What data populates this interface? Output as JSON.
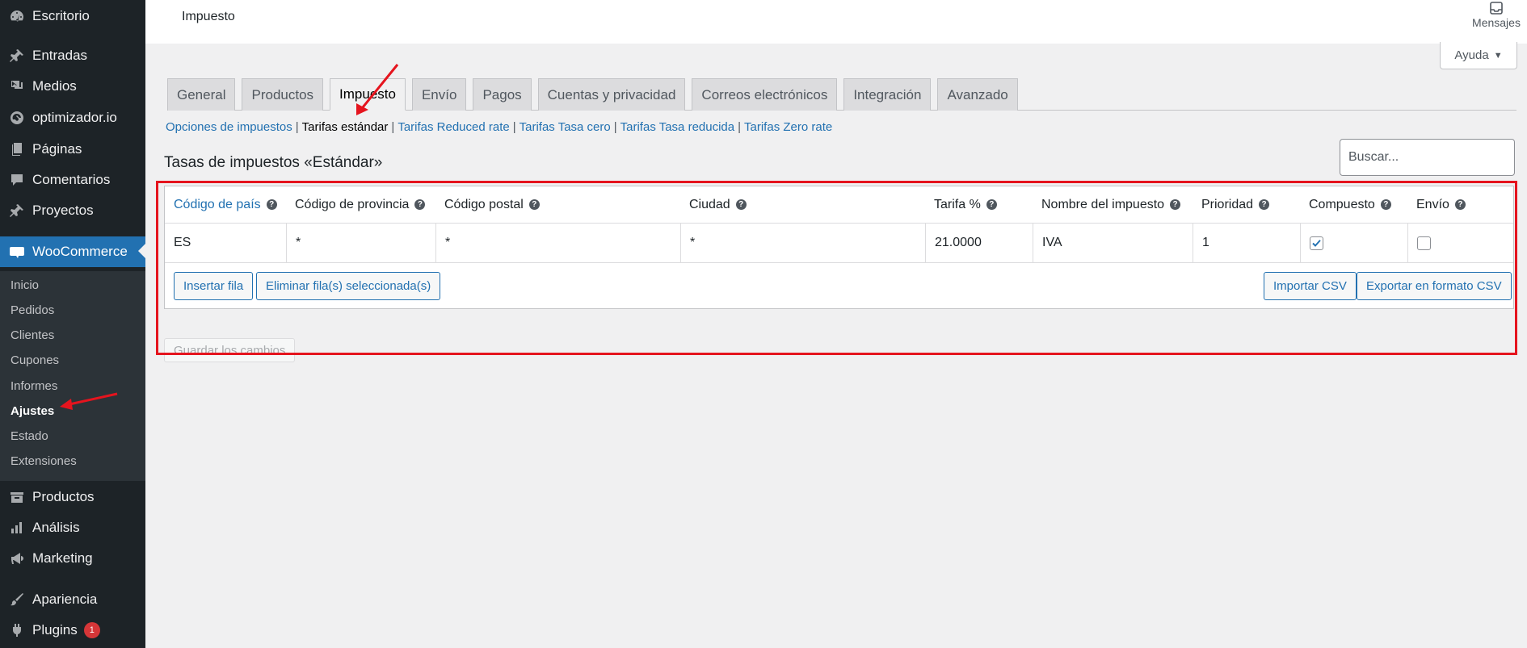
{
  "sidebar": {
    "items": [
      {
        "label": "Escritorio",
        "icon": "dashboard-icon"
      },
      {
        "label": "Entradas",
        "icon": "pin-icon"
      },
      {
        "label": "Medios",
        "icon": "media-icon"
      },
      {
        "label": "optimizador.io",
        "icon": "gauge-icon"
      },
      {
        "label": "Páginas",
        "icon": "pages-icon"
      },
      {
        "label": "Comentarios",
        "icon": "comment-icon"
      },
      {
        "label": "Proyectos",
        "icon": "pin-icon"
      },
      {
        "label": "WooCommerce",
        "icon": "woo-icon"
      },
      {
        "label": "Productos",
        "icon": "archive-icon"
      },
      {
        "label": "Análisis",
        "icon": "chart-bar-icon"
      },
      {
        "label": "Marketing",
        "icon": "megaphone-icon"
      },
      {
        "label": "Apariencia",
        "icon": "brush-icon"
      },
      {
        "label": "Plugins",
        "icon": "plugin-icon"
      }
    ],
    "plugins_badge": "1",
    "woo_submenu": [
      "Inicio",
      "Pedidos",
      "Clientes",
      "Cupones",
      "Informes",
      "Ajustes",
      "Estado",
      "Extensiones"
    ]
  },
  "topbar": {
    "heading": "Impuesto",
    "inbox_label": "Mensajes",
    "help_label": "Ayuda"
  },
  "tabs": [
    "General",
    "Productos",
    "Impuesto",
    "Envío",
    "Pagos",
    "Cuentas y privacidad",
    "Correos electrónicos",
    "Integración",
    "Avanzado"
  ],
  "active_tab": "Impuesto",
  "sublinks": [
    "Opciones de impuestos",
    "Tarifas estándar",
    "Tarifas Reduced rate",
    "Tarifas Tasa cero",
    "Tarifas Tasa reducida",
    "Tarifas Zero rate"
  ],
  "active_sublink": "Tarifas estándar",
  "section_title": "Tasas de impuestos «Estándar»",
  "search": {
    "placeholder": "Buscar..."
  },
  "table": {
    "headers": [
      "Código de país",
      "Código de provincia",
      "Código postal",
      "Ciudad",
      "Tarifa %",
      "Nombre del impuesto",
      "Prioridad",
      "Compuesto",
      "Envío"
    ],
    "row": {
      "country": "ES",
      "state": "*",
      "postcode": "*",
      "city": "*",
      "rate": "21.0000",
      "name": "IVA",
      "priority": "1",
      "compound": true,
      "shipping": false
    },
    "buttons": {
      "insert": "Insertar fila",
      "remove": "Eliminar fila(s) seleccionada(s)",
      "import": "Importar CSV",
      "export": "Exportar en formato CSV"
    }
  },
  "save_label": "Guardar los cambios",
  "colors": {
    "sidebar_bg": "#1d2327",
    "accent": "#2271b1",
    "annotation": "#e5141e"
  }
}
